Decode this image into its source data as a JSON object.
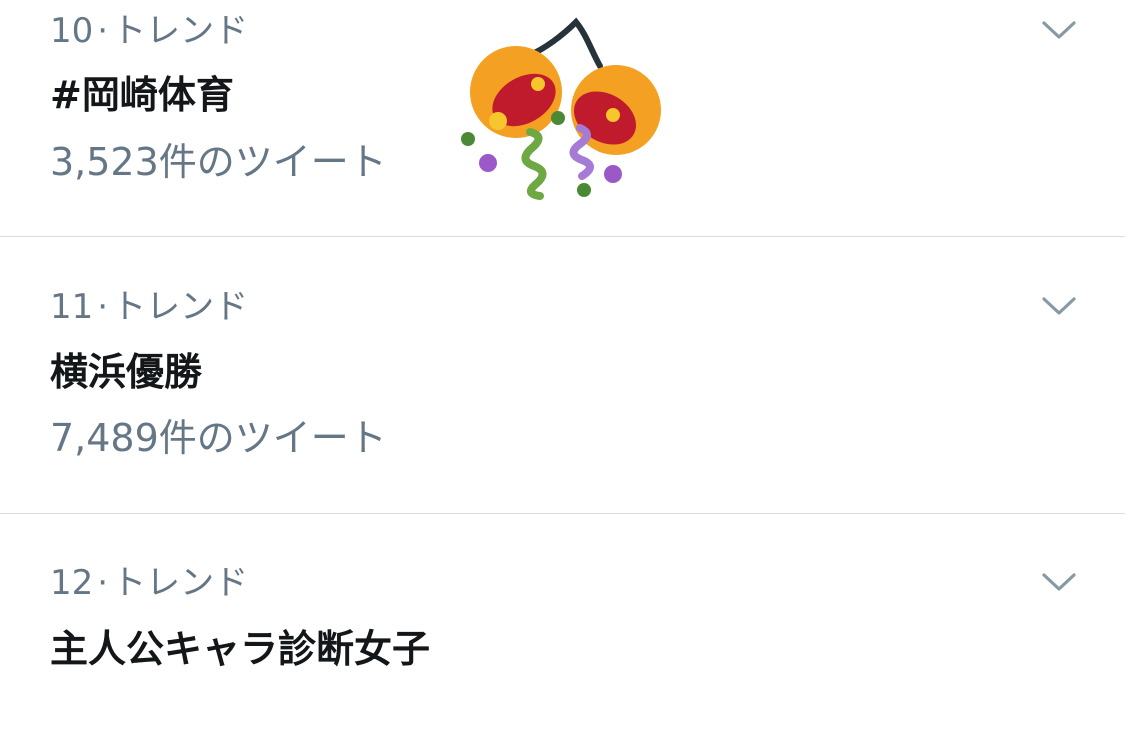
{
  "trends": [
    {
      "rank": "10",
      "separator": "·",
      "label": "トレンド",
      "title": "#岡崎体育",
      "count": "3,523件のツイート",
      "icon": "party-popper-icon"
    },
    {
      "rank": "11",
      "separator": "·",
      "label": "トレンド",
      "title": "横浜優勝",
      "count": "7,489件のツイート"
    },
    {
      "rank": "12",
      "separator": "·",
      "label": "トレンド",
      "title": "主人公キャラ診断女子"
    }
  ],
  "colors": {
    "secondary_text": "#657786",
    "primary_text": "#14171a",
    "divider": "#d9dde0",
    "chevron": "#8899a6"
  },
  "icons": {
    "more": "chevron-down-icon",
    "emoji": "party-popper-icon"
  }
}
